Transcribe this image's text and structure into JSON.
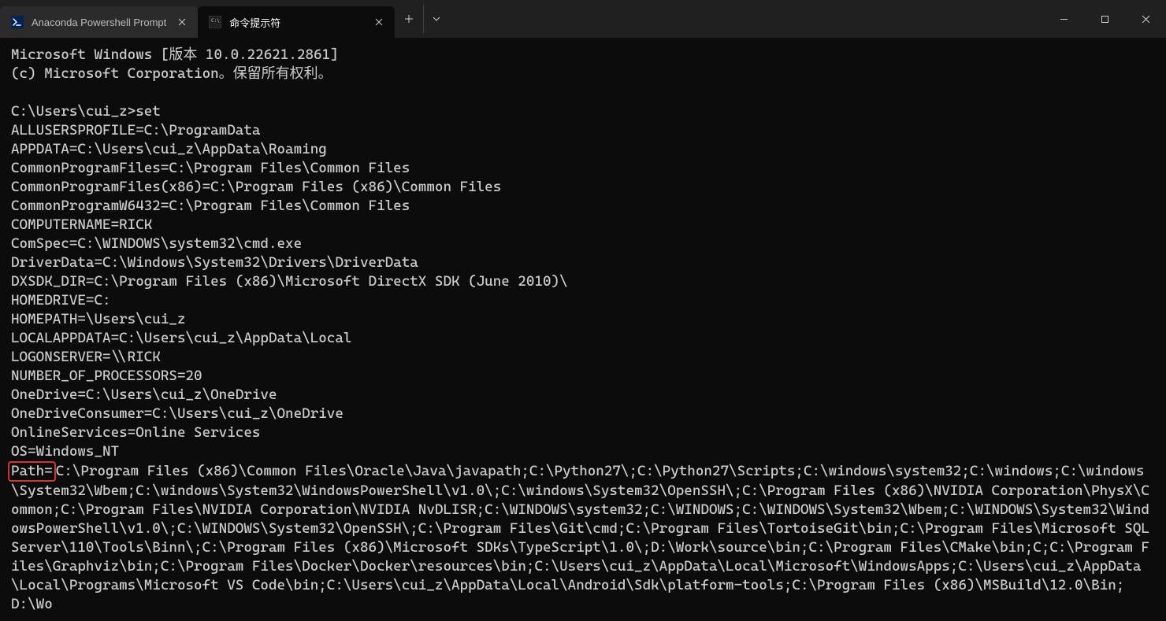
{
  "tabs": [
    {
      "label": "Anaconda Powershell Prompt",
      "icon": "powershell",
      "active": false
    },
    {
      "label": "命令提示符",
      "icon": "cmd",
      "active": true
    }
  ],
  "terminal": {
    "banner_lines": [
      "Microsoft Windows [版本 10.0.22621.2861]",
      "(c) Microsoft Corporation。保留所有权利。"
    ],
    "prompt": "C:\\Users\\cui_z>",
    "command": "set",
    "env_lines": [
      "ALLUSERSPROFILE=C:\\ProgramData",
      "APPDATA=C:\\Users\\cui_z\\AppData\\Roaming",
      "CommonProgramFiles=C:\\Program Files\\Common Files",
      "CommonProgramFiles(x86)=C:\\Program Files (x86)\\Common Files",
      "CommonProgramW6432=C:\\Program Files\\Common Files",
      "COMPUTERNAME=RICK",
      "ComSpec=C:\\WINDOWS\\system32\\cmd.exe",
      "DriverData=C:\\Windows\\System32\\Drivers\\DriverData",
      "DXSDK_DIR=C:\\Program Files (x86)\\Microsoft DirectX SDK (June 2010)\\",
      "HOMEDRIVE=C:",
      "HOMEPATH=\\Users\\cui_z",
      "LOCALAPPDATA=C:\\Users\\cui_z\\AppData\\Local",
      "LOGONSERVER=\\\\RICK",
      "NUMBER_OF_PROCESSORS=20",
      "OneDrive=C:\\Users\\cui_z\\OneDrive",
      "OneDriveConsumer=C:\\Users\\cui_z\\OneDrive",
      "OnlineServices=Online Services",
      "OS=Windows_NT"
    ],
    "path_label": "Path=",
    "path_value": "C:\\Program Files (x86)\\Common Files\\Oracle\\Java\\javapath;C:\\Python27\\;C:\\Python27\\Scripts;C:\\windows\\system32;C:\\windows;C:\\windows\\System32\\Wbem;C:\\windows\\System32\\WindowsPowerShell\\v1.0\\;C:\\windows\\System32\\OpenSSH\\;C:\\Program Files (x86)\\NVIDIA Corporation\\PhysX\\Common;C:\\Program Files\\NVIDIA Corporation\\NVIDIA NvDLISR;C:\\WINDOWS\\system32;C:\\WINDOWS;C:\\WINDOWS\\System32\\Wbem;C:\\WINDOWS\\System32\\WindowsPowerShell\\v1.0\\;C:\\WINDOWS\\System32\\OpenSSH\\;C:\\Program Files\\Git\\cmd;C:\\Program Files\\TortoiseGit\\bin;C:\\Program Files\\Microsoft SQL Server\\110\\Tools\\Binn\\;C:\\Program Files (x86)\\Microsoft SDKs\\TypeScript\\1.0\\;D:\\Work\\source\\bin;C:\\Program Files\\CMake\\bin;C;C:\\Program Files\\Graphviz\\bin;C:\\Program Files\\Docker\\Docker\\resources\\bin;C:\\Users\\cui_z\\AppData\\Local\\Microsoft\\WindowsApps;C:\\Users\\cui_z\\AppData\\Local\\Programs\\Microsoft VS Code\\bin;C:\\Users\\cui_z\\AppData\\Local\\Android\\Sdk\\platform-tools;C:\\Program Files (x86)\\MSBuild\\12.0\\Bin;D:\\Wo"
  },
  "colors": {
    "highlight_border": "#d13438"
  }
}
